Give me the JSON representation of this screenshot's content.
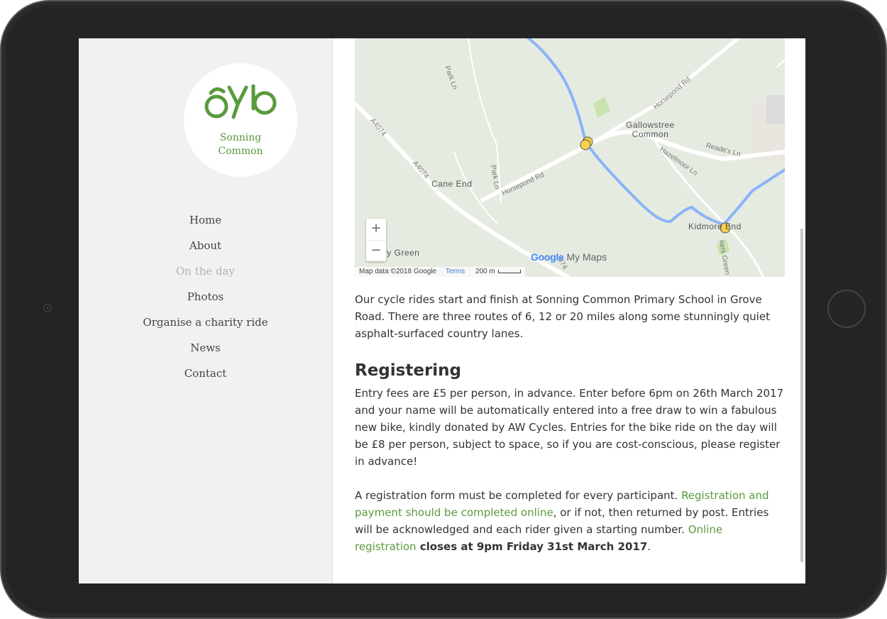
{
  "brand": {
    "name_line1": "Sonning",
    "name_line2": "Common",
    "color": "#5a9a3e"
  },
  "nav": {
    "items": [
      {
        "label": "Home",
        "active": false
      },
      {
        "label": "About",
        "active": false
      },
      {
        "label": "On the day",
        "active": true
      },
      {
        "label": "Photos",
        "active": false
      },
      {
        "label": "Organise a charity ride",
        "active": false
      },
      {
        "label": "News",
        "active": false
      },
      {
        "label": "Contact",
        "active": false
      }
    ]
  },
  "map": {
    "places": {
      "gallowstree": "Gallowstree\nCommon",
      "cane_end": "Cane End",
      "kidmore_end": "Kidmore End",
      "ley_green": "ey Green"
    },
    "roads": {
      "park_ln_1": "Park Ln",
      "park_ln_2": "Park Ln",
      "a4074_1": "A4074",
      "a4074_2": "A4074",
      "a4074_3": "074",
      "horsepond_1": "Horsepond Rd",
      "horsepond_2": "Horsepond Rd",
      "hazelmoor": "Hazelmoor Ln",
      "reades": "Reade's Ln",
      "bakers_green": "kers Green Ln"
    },
    "zoom_in": "+",
    "zoom_out": "−",
    "attribution": "Map data ©2018 Google",
    "terms": "Terms",
    "scale": "200 m",
    "logo_google": "Google",
    "logo_mymaps": "My Maps",
    "route_color": "#8ab4f8",
    "marker_color": "#f7d04e"
  },
  "content": {
    "intro": "Our cycle rides start and finish at Sonning Common Primary School in Grove Road. There are three routes of 6, 12 or 20 miles along some stunningly quiet asphalt-surfaced country lanes.",
    "heading": "Registering",
    "p1": "Entry fees are £5 per person, in advance. Enter before 6pm on 26th March 2017 and your name will be automatically entered into a free draw to win a fabulous new bike, kindly donated by AW Cycles. Entries for the bike ride on the day will be £8 per person, subject to space, so if you are cost-conscious, please register in advance!",
    "p2_a": "A registration form must be completed for every participant. ",
    "p2_link1": "Registration and payment should be completed online",
    "p2_b": ", or if not, then returned by post. Entries will be acknowledged and each rider given a starting number. ",
    "p2_link2": "Online registration",
    "p2_c": " closes at 9pm Friday 31st March 2017",
    "p2_d": "."
  }
}
